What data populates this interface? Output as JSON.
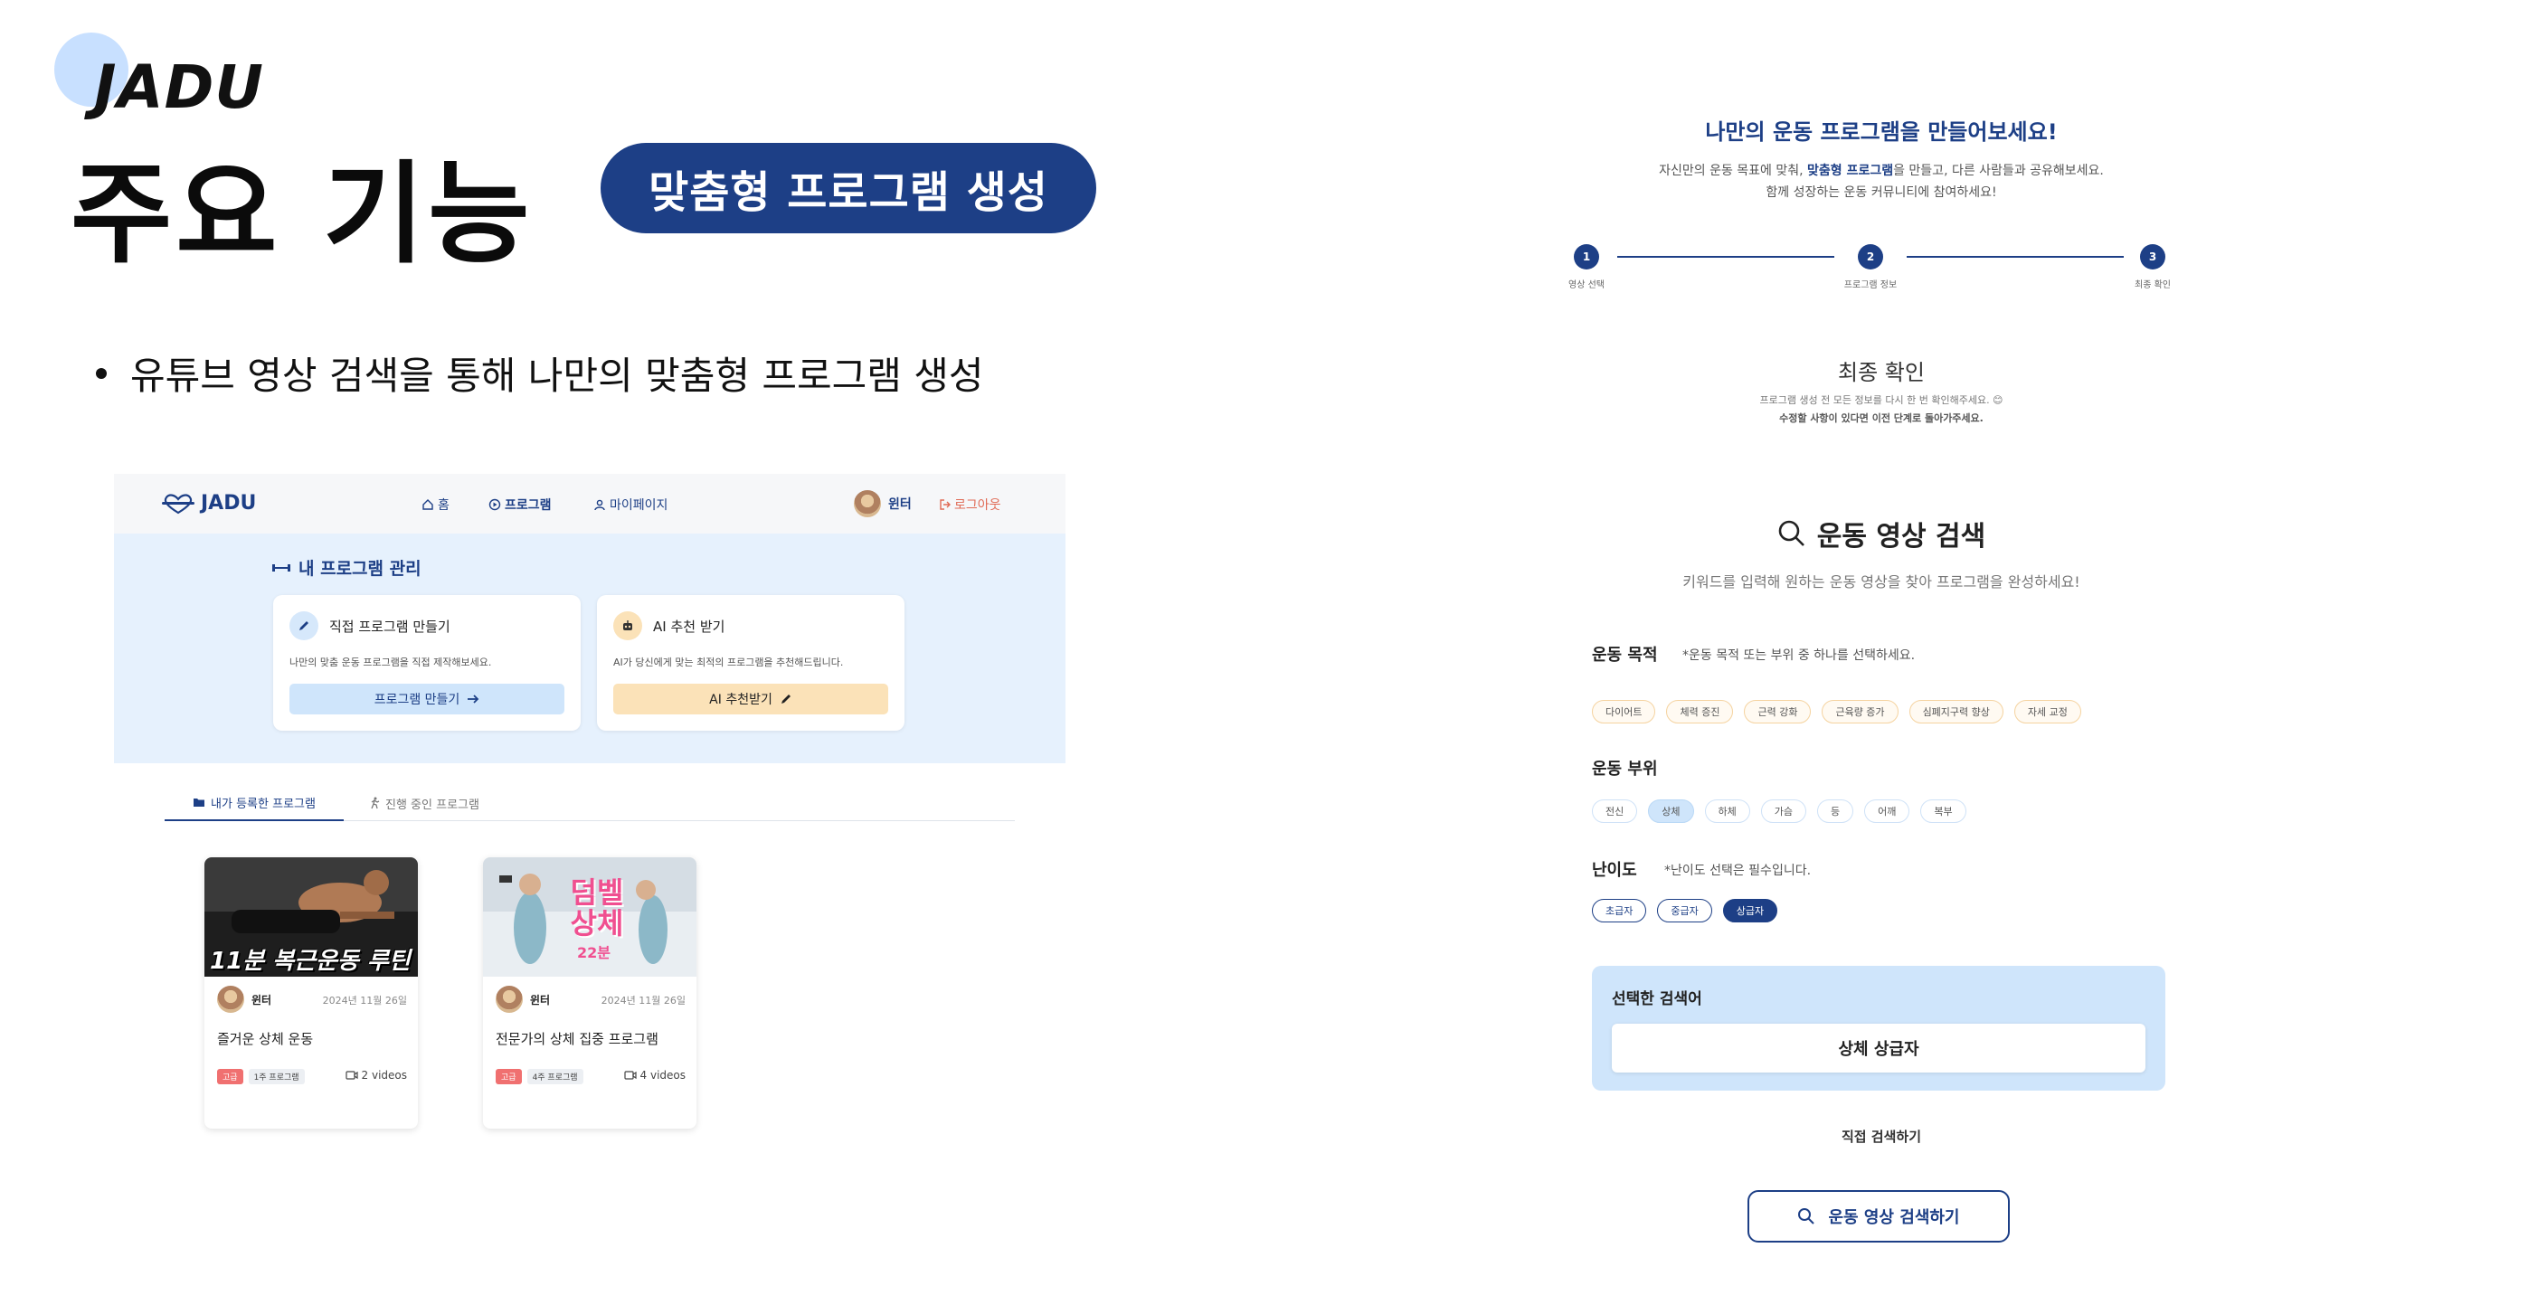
{
  "slide": {
    "brand": "JADU",
    "title": "주요 기능",
    "feature_pill": "맞춤형 프로그램 생성",
    "bullet": "유튜브 영상 검색을 통해 나만의 맞춤형 프로그램 생성"
  },
  "left_screen": {
    "nav": {
      "logo": "JADU",
      "links": [
        "홈",
        "프로그램",
        "마이페이지"
      ],
      "user_name": "윈터",
      "logout": "로그아웃"
    },
    "manage": {
      "title": "내 프로그램 관리",
      "cards": [
        {
          "title": "직접 프로그램 만들기",
          "desc": "나만의 맞춤 운동 프로그램을 직접 제작해보세요.",
          "button": "프로그램 만들기"
        },
        {
          "title": "AI 추천 받기",
          "desc": "AI가 당신에게 맞는 최적의 프로그램을 추천해드립니다.",
          "button": "AI 추천받기"
        }
      ]
    },
    "tabs": [
      "내가 등록한 프로그램",
      "진행 중인 프로그램"
    ],
    "programs": [
      {
        "thumb_text": "11분 복근운동 루틴",
        "thumb_sub": "",
        "user": "윈터",
        "date": "2024년 11월 26일",
        "title": "즐거운 상체 운동",
        "level": "고급",
        "type": "1주 프로그램",
        "videos": "2 videos"
      },
      {
        "thumb_text": "덤벨 상체",
        "thumb_sub": "22분",
        "user": "윈터",
        "date": "2024년 11월 26일",
        "title": "전문가의 상체 집중 프로그램",
        "level": "고급",
        "type": "4주 프로그램",
        "videos": "4 videos"
      }
    ]
  },
  "right_screen": {
    "title": "나만의 운동 프로그램을 만들어보세요!",
    "desc1_pre": "자신만의 운동 목표에 맞춰, ",
    "desc1_bold": "맞춤형 프로그램",
    "desc1_post": "을 만들고, 다른 사람들과 공유해보세요.",
    "desc2": "함께 성장하는 운동 커뮤니티에 참여하세요!",
    "steps": [
      {
        "num": "1",
        "label": "영상 선택"
      },
      {
        "num": "2",
        "label": "프로그램 정보"
      },
      {
        "num": "3",
        "label": "최종 확인"
      }
    ],
    "final_title": "최종 확인",
    "final_desc1": "프로그램 생성 전 모든 정보를 다시 한 번 확인해주세요. 😊",
    "final_desc2": "수정할 사항이 있다면 이전 단계로 돌아가주세요.",
    "search_title": "운동 영상 검색",
    "search_sub": "키워드를 입력해 원하는 운동 영상을 찾아 프로그램을 완성하세요!",
    "purpose_label": "운동 목적",
    "purpose_note": "*운동 목적 또는 부위 중 하나를 선택하세요.",
    "purposes": [
      "다이어트",
      "체력 증진",
      "근력 강화",
      "근육량 증가",
      "심폐지구력 향상",
      "자세 교정"
    ],
    "part_label": "운동 부위",
    "parts": [
      "전신",
      "상체",
      "하체",
      "가슴",
      "등",
      "어깨",
      "복부"
    ],
    "selected_part": "상체",
    "level_label": "난이도",
    "level_note": "*난이도 선택은 필수입니다.",
    "levels": [
      "초급자",
      "중급자",
      "상급자"
    ],
    "selected_level": "상급자",
    "selected_label": "선택한 검색어",
    "selected_value": "상체 상급자",
    "direct_search": "직접 검색하기",
    "search_button": "운동 영상 검색하기"
  },
  "colors": {
    "primary": "#1d3f86",
    "light_blue": "#cfe5fb",
    "accent_red": "#f07070",
    "panel": "#e6f1fd"
  }
}
